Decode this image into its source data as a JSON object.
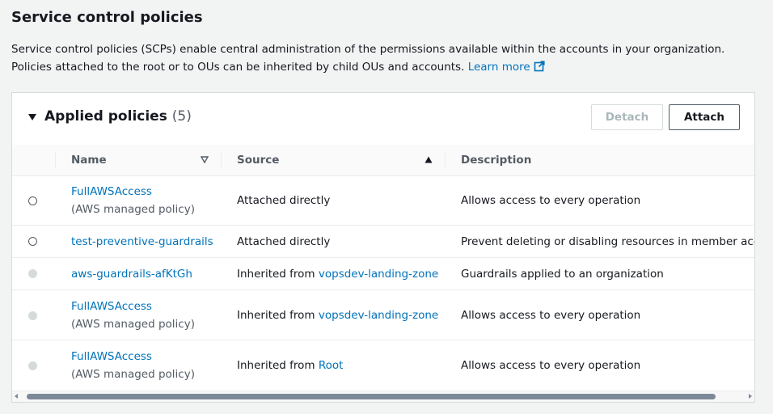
{
  "section": {
    "title": "Service control policies",
    "description": "Service control policies (SCPs) enable central administration of the permissions available within the accounts in your organization. Policies attached to the root or to OUs can be inherited by child OUs and accounts.",
    "learn_more": "Learn more"
  },
  "panel": {
    "title": "Applied policies",
    "count": "(5)",
    "detach_label": "Detach",
    "attach_label": "Attach"
  },
  "table": {
    "columns": {
      "name": "Name",
      "source": "Source",
      "description": "Description"
    },
    "rows": [
      {
        "name": "FullAWSAccess",
        "name_sub": "(AWS managed policy)",
        "source_prefix": "Attached directly",
        "source_link": "",
        "description": "Allows access to every operation",
        "selectable": true
      },
      {
        "name": "test-preventive-guardrails",
        "name_sub": "",
        "source_prefix": "Attached directly",
        "source_link": "",
        "description": "Prevent deleting or disabling resources in member accour",
        "selectable": true
      },
      {
        "name": "aws-guardrails-afKtGh",
        "name_sub": "",
        "source_prefix": "Inherited from ",
        "source_link": "vopsdev-landing-zone",
        "description": "Guardrails applied to an organization",
        "selectable": false
      },
      {
        "name": "FullAWSAccess",
        "name_sub": "(AWS managed policy)",
        "source_prefix": "Inherited from ",
        "source_link": "vopsdev-landing-zone",
        "description": "Allows access to every operation",
        "selectable": false
      },
      {
        "name": "FullAWSAccess",
        "name_sub": "(AWS managed policy)",
        "source_prefix": "Inherited from ",
        "source_link": "Root",
        "description": "Allows access to every operation",
        "selectable": false
      }
    ]
  },
  "colors": {
    "link": "#0073bb",
    "text": "#16191f",
    "secondary_text": "#545b64",
    "disabled": "#aab7b8"
  },
  "icons": {
    "external_link": "external-link-icon",
    "collapse": "caret-down-icon",
    "sort_name": "sort-triangle-down-icon",
    "sort_source": "sort-ascending-icon"
  }
}
